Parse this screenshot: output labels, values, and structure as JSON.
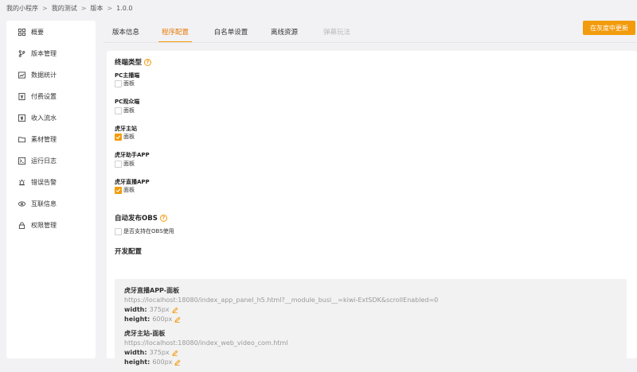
{
  "breadcrumb": [
    "我的小程序",
    "我的测试",
    "版本",
    "1.0.0"
  ],
  "breadcrumb_sep": ">",
  "sidebar": {
    "items": [
      {
        "label": "概要",
        "icon": "grid-icon"
      },
      {
        "label": "版本管理",
        "icon": "branch-icon"
      },
      {
        "label": "数据统计",
        "icon": "chart-icon"
      },
      {
        "label": "付费设置",
        "icon": "payment-icon"
      },
      {
        "label": "收入流水",
        "icon": "income-icon"
      },
      {
        "label": "素材管理",
        "icon": "folder-icon"
      },
      {
        "label": "运行日志",
        "icon": "log-icon"
      },
      {
        "label": "错误告警",
        "icon": "alarm-icon"
      },
      {
        "label": "互联信息",
        "icon": "link-icon"
      },
      {
        "label": "权限管理",
        "icon": "lock-icon"
      }
    ]
  },
  "tabs": [
    {
      "label": "版本信息",
      "state": "normal"
    },
    {
      "label": "程序配置",
      "state": "active"
    },
    {
      "label": "白名单设置",
      "state": "normal"
    },
    {
      "label": "离线资源",
      "state": "normal"
    },
    {
      "label": "弹幕玩法",
      "state": "disabled"
    }
  ],
  "primary_button": "在灰度中更新",
  "terminal_section": {
    "title": "终端类型",
    "terminals": [
      {
        "name": "PC主播端",
        "option": "面板",
        "checked": false
      },
      {
        "name": "PC观众端",
        "option": "面板",
        "checked": false
      },
      {
        "name": "虎牙主站",
        "option": "面板",
        "checked": true
      },
      {
        "name": "虎牙助手APP",
        "option": "面板",
        "checked": false
      },
      {
        "name": "虎牙直播APP",
        "option": "面板",
        "checked": true
      }
    ]
  },
  "obs_section": {
    "title": "自动发布OBS",
    "option": "是否支持在OBS使用",
    "checked": false
  },
  "dev_section": {
    "title": "开发配置",
    "entries": [
      {
        "name": "虎牙直播APP-面板",
        "url": "https://localhost:18080/index_app_panel_h5.html?__module_busi__=kiwi-ExtSDK&scrollEnabled=0",
        "width_label": "width:",
        "width_value": "375px",
        "height_label": "height:",
        "height_value": "600px"
      },
      {
        "name": "虎牙主站-面板",
        "url": "https://localhost:18080/index_web_video_com.html",
        "width_label": "width:",
        "width_value": "375px",
        "height_label": "height:",
        "height_value": "600px"
      }
    ]
  },
  "colors": {
    "accent": "#f29b0d",
    "background": "#f2f2f4",
    "muted_text": "#999999"
  }
}
